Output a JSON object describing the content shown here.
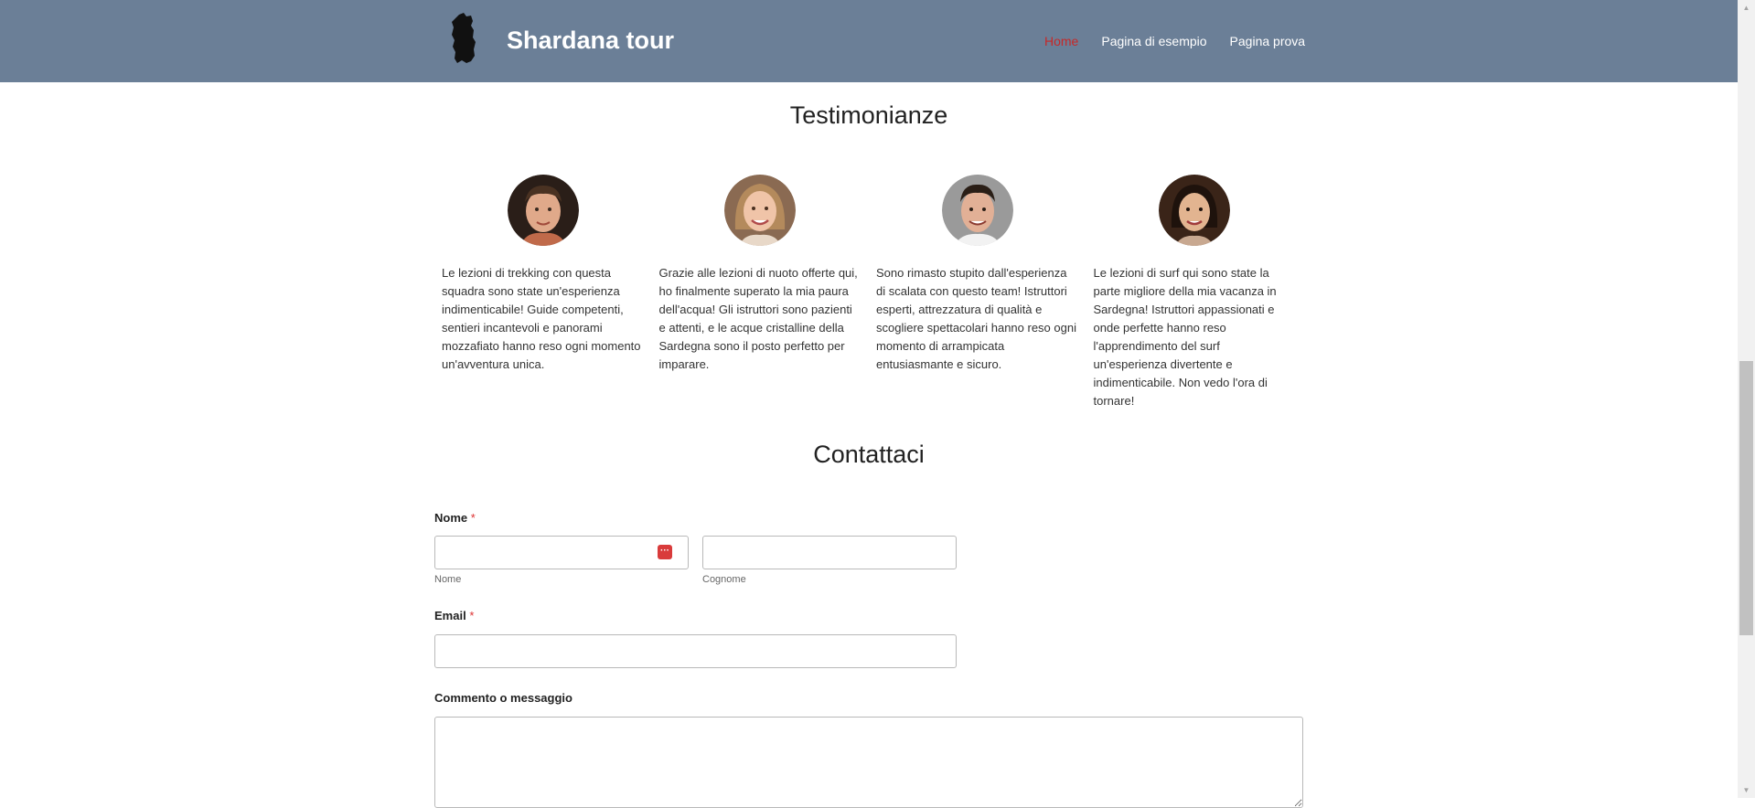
{
  "header": {
    "site_title": "Shardana tour",
    "logo_icon": "sardinia-island-icon",
    "nav": [
      {
        "label": "Home",
        "active": true
      },
      {
        "label": "Pagina di esempio",
        "active": false
      },
      {
        "label": "Pagina prova",
        "active": false
      }
    ]
  },
  "testimonials": {
    "title": "Testimonianze",
    "items": [
      {
        "avatar": "young-man-photo",
        "text": "Le lezioni di trekking con questa squadra sono state un'esperienza indimenticabile! Guide competenti, sentieri incantevoli e panorami mozzafiato hanno reso ogni momento un'avventura unica."
      },
      {
        "avatar": "woman-blonde-photo",
        "text": "Grazie alle lezioni di nuoto offerte qui, ho finalmente superato la mia paura dell'acqua! Gli istruttori sono pazienti e attenti, e le acque cristalline della Sardegna sono il posto perfetto per imparare."
      },
      {
        "avatar": "man-dark-hair-photo",
        "text": "Sono rimasto stupito dall'esperienza di scalata con questo team! Istruttori esperti, attrezzatura di qualità e scogliere spettacolari hanno reso ogni momento di arrampicata entusiasmante e sicuro."
      },
      {
        "avatar": "asian-woman-photo",
        "text": "Le lezioni di surf qui sono state la parte migliore della mia vacanza in Sardegna! Istruttori appassionati e onde perfette hanno reso l'apprendimento del surf un'esperienza divertente e indimenticabile. Non vedo l'ora di tornare!"
      }
    ]
  },
  "contact": {
    "title": "Contattaci",
    "name_label": "Nome",
    "required_mark": "*",
    "first_name_sublabel": "Nome",
    "last_name_sublabel": "Cognome",
    "first_name_value": "",
    "last_name_value": "",
    "email_label": "Email",
    "email_value": "",
    "message_label": "Commento o messaggio",
    "message_value": ""
  },
  "colors": {
    "header_bg": "#6b7f97",
    "active_nav": "#c62828",
    "required": "#dd3333"
  }
}
